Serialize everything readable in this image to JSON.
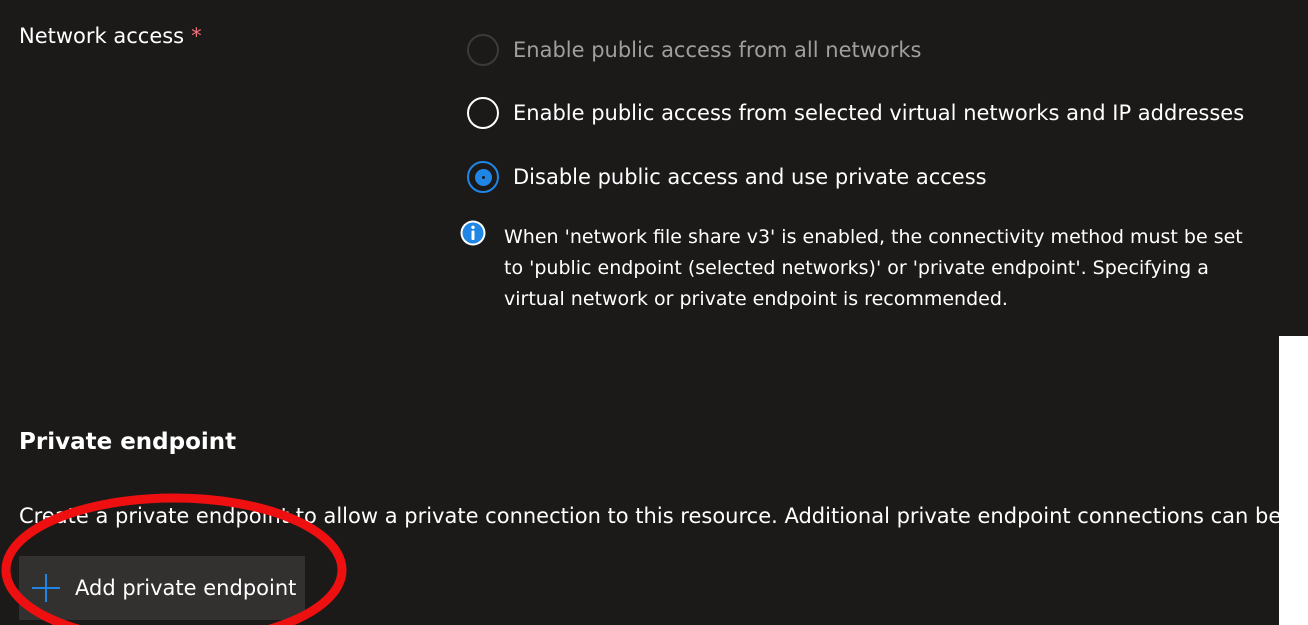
{
  "network_access": {
    "label": "Network access",
    "required_marker": "*",
    "options": [
      {
        "label": "Enable public access from all networks",
        "state": "disabled"
      },
      {
        "label": "Enable public access from selected virtual networks and IP addresses",
        "state": "unchecked"
      },
      {
        "label": "Disable public access and use private access",
        "state": "checked"
      }
    ],
    "info_icon": "info-icon",
    "info_message": "When 'network file share v3' is enabled, the connectivity method must be set to 'public endpoint (selected networks)' or 'private endpoint'. Specifying a virtual network or private endpoint is recommended."
  },
  "private_endpoint": {
    "heading": "Private endpoint",
    "description": "Create a private endpoint to allow a private connection to this resource. Additional private endpoint connections can be created",
    "add_button_label": "Add private endpoint",
    "add_button_icon": "plus-icon"
  },
  "annotation": {
    "color": "#ee1010"
  },
  "colors": {
    "accent": "#1f86e6",
    "background": "#1b1a19",
    "required": "#f1707b",
    "button_background": "#323130"
  }
}
